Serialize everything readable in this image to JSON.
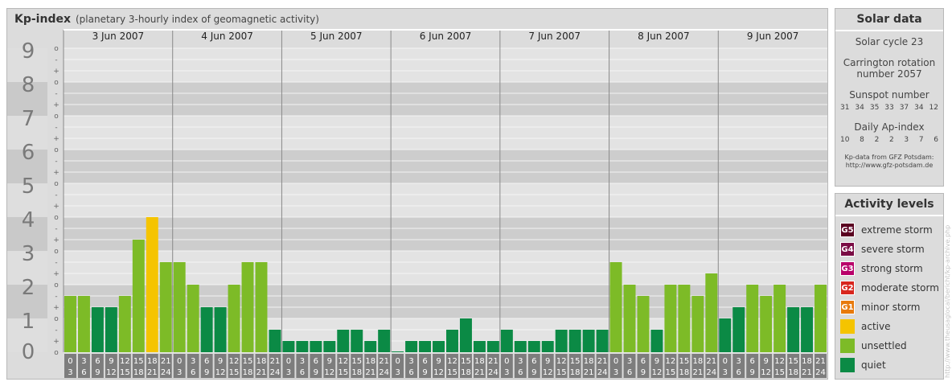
{
  "chart_data": {
    "type": "bar",
    "title": "Kp-index",
    "subtitle": "(planetary 3-hourly index of geomagnetic activity)",
    "days": [
      "3 Jun 2007",
      "4 Jun 2007",
      "5 Jun 2007",
      "6 Jun 2007",
      "7 Jun 2007",
      "8 Jun 2007",
      "9 Jun 2007"
    ],
    "interval_labels": [
      [
        "0",
        "3"
      ],
      [
        "3",
        "6"
      ],
      [
        "6",
        "9"
      ],
      [
        "9",
        "12"
      ],
      [
        "12",
        "15"
      ],
      [
        "15",
        "18"
      ],
      [
        "18",
        "21"
      ],
      [
        "21",
        "24"
      ]
    ],
    "y_major_ticks": [
      "0",
      "1",
      "2",
      "3",
      "4",
      "5",
      "6",
      "7",
      "8",
      "9"
    ],
    "y_minor_ticks": [
      "o",
      "+",
      "-"
    ],
    "ylim": [
      0,
      9
    ],
    "values": [
      1.667,
      1.667,
      1.333,
      1.333,
      1.667,
      3.333,
      4.0,
      2.667,
      2.667,
      2.0,
      1.333,
      1.333,
      2.0,
      2.667,
      2.667,
      0.667,
      0.333,
      0.333,
      0.333,
      0.333,
      0.667,
      0.667,
      0.333,
      0.667,
      0.0,
      0.333,
      0.333,
      0.333,
      0.667,
      1.0,
      0.333,
      0.333,
      0.667,
      0.333,
      0.333,
      0.333,
      0.667,
      0.667,
      0.667,
      0.667,
      2.667,
      2.0,
      1.667,
      0.667,
      2.0,
      2.0,
      1.667,
      2.333,
      1.0,
      1.333,
      2.0,
      1.667,
      2.0,
      1.333,
      1.333,
      2.0
    ],
    "level_colors": {
      "quiet": "#0b8a45",
      "unsettled": "#7dbb27",
      "active": "#f5c400"
    }
  },
  "solar": {
    "title": "Solar data",
    "cycle": "Solar cycle 23",
    "carrington_1": "Carrington rotation",
    "carrington_2": "number 2057",
    "sunspot_label": "Sunspot number",
    "sunspot": [
      "31",
      "34",
      "35",
      "33",
      "37",
      "34",
      "12"
    ],
    "ap_label": "Daily Ap-index",
    "ap": [
      "10",
      "8",
      "2",
      "2",
      "3",
      "7",
      "6"
    ],
    "credit_1": "Kp-data from GFZ Potsdam:",
    "credit_2": "http://www.gfz-potsdam.de"
  },
  "levels": {
    "title": "Activity levels",
    "items": [
      {
        "code": "G5",
        "label": "extreme storm",
        "color": "#5a0020"
      },
      {
        "code": "G4",
        "label": "severe storm",
        "color": "#7a0c44"
      },
      {
        "code": "G3",
        "label": "strong storm",
        "color": "#b8006a"
      },
      {
        "code": "G2",
        "label": "moderate storm",
        "color": "#d8261e"
      },
      {
        "code": "G1",
        "label": "minor storm",
        "color": "#e87a0c"
      },
      {
        "code": "",
        "label": "active",
        "color": "#f5c400"
      },
      {
        "code": "",
        "label": "unsettled",
        "color": "#7dbb27"
      },
      {
        "code": "",
        "label": "quiet",
        "color": "#0b8a45"
      }
    ]
  },
  "watermark": "http://www.theusaglocal/bericht/kp-archive.php"
}
